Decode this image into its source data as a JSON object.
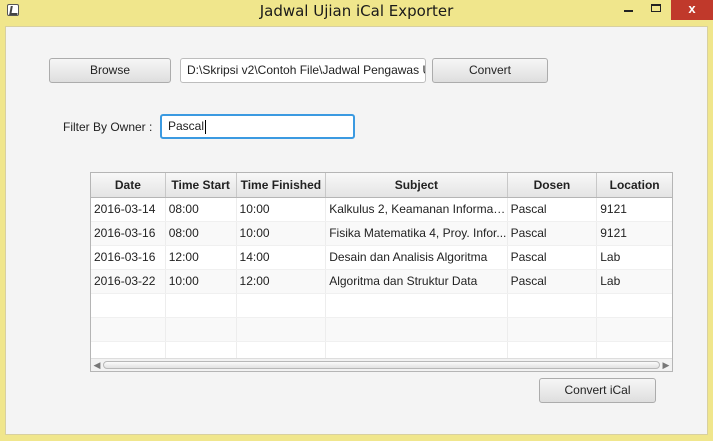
{
  "window": {
    "title": "Jadwal Ujian iCal Exporter",
    "close_glyph": "x"
  },
  "toolbar": {
    "browse_label": "Browse",
    "file_path": "D:\\Skripsi v2\\Contoh File\\Jadwal Pengawas U",
    "convert_label": "Convert"
  },
  "filter": {
    "label": "Filter By Owner :",
    "value": "Pascal"
  },
  "table": {
    "columns": [
      "Date",
      "Time Start",
      "Time Finished",
      "Subject",
      "Dosen",
      "Location"
    ],
    "rows": [
      [
        "2016-03-14",
        "08:00",
        "10:00",
        "Kalkulus 2, Keamanan Informas...",
        "Pascal",
        "9121"
      ],
      [
        "2016-03-16",
        "08:00",
        "10:00",
        "Fisika Matematika 4, Proy. Infor...",
        "Pascal",
        "9121"
      ],
      [
        "2016-03-16",
        "12:00",
        "14:00",
        "Desain dan Analisis Algoritma",
        "Pascal",
        "Lab"
      ],
      [
        "2016-03-22",
        "10:00",
        "12:00",
        "Algoritma dan Struktur Data",
        "Pascal",
        "Lab"
      ]
    ]
  },
  "footer": {
    "convert_ical_label": "Convert iCal"
  },
  "colors": {
    "window_frame": "#f0e68c",
    "close_button": "#c0392b",
    "focus_border": "#3b9ae1"
  }
}
